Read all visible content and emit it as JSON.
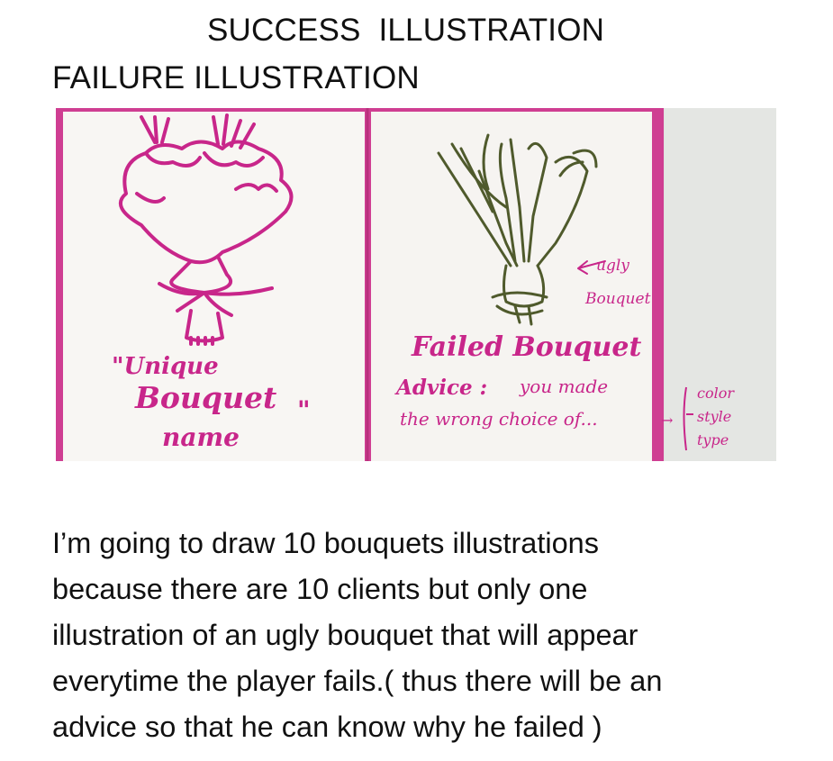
{
  "headings": {
    "success": "SUCCESS  ILLUSTRATION",
    "failure": "FAILURE ILLUSTRATION"
  },
  "sketch": {
    "left_page": {
      "caption_line1": "\"Unique",
      "caption_line2": "Bouquet",
      "caption_close": "\"",
      "caption_line3": "name"
    },
    "right_page": {
      "annotation_line1": "ugly",
      "annotation_line2": "Bouquet",
      "title": "Failed Bouquet",
      "advice_label": "Advice :",
      "advice_text_1": "you made",
      "advice_text_2": "the wrong choice of...",
      "arrow": "→",
      "options": [
        "color",
        "style",
        "type"
      ]
    },
    "colors": {
      "magenta_ink": "#c8268a",
      "green_ink": "#4f5a2c",
      "paper": "#f8f6f3",
      "notebook_cover": "#cf3e92"
    }
  },
  "description": {
    "lines": [
      "I’m going to draw 10 bouquets illustrations",
      "because there are 10 clients but only one",
      "illustration of an ugly bouquet that will appear",
      "everytime the player fails.( thus there will be an",
      "advice so that he can know why he failed )"
    ]
  }
}
